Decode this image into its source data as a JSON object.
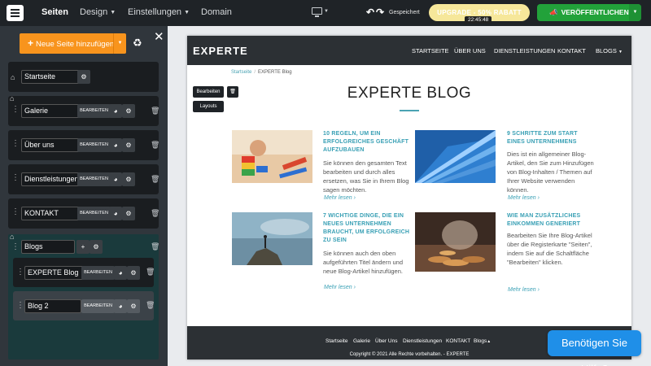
{
  "topbar": {
    "nav": [
      "Seiten",
      "Design",
      "Einstellungen",
      "Domain"
    ],
    "saved_label": "Gespeichert",
    "upgrade_label": "UPGRADE - 50% RABATT",
    "timer": "22:45:48",
    "publish_label": "VERÖFFENTLICHEN",
    "icons": [
      "menu-icon",
      "monitor-icon",
      "undo-icon",
      "redo-icon",
      "megaphone-icon"
    ]
  },
  "sidebar": {
    "add_page_label": "Neue Seite hinzufügen",
    "edit_label": "BEARBEITEN",
    "pages": [
      {
        "name": "Startseite"
      },
      {
        "name": "Galerie"
      },
      {
        "name": "Über uns"
      },
      {
        "name": "Dienstleistungen"
      },
      {
        "name": "KONTAKT"
      },
      {
        "name": "Blogs"
      }
    ],
    "subpages": [
      {
        "name": "EXPERTE Blog"
      },
      {
        "name": "Blog 2"
      }
    ],
    "group_color": "#1a3a3c"
  },
  "site": {
    "logo": "EXPERTE",
    "nav": [
      "STARTSEITE",
      "ÜBER UNS",
      "DIENSTLEISTUNGEN",
      "KONTAKT",
      "BLOGS"
    ],
    "breadcrumb": [
      "Startseite",
      "EXPERTE Blog"
    ],
    "edit_btn": "Bearbeiten",
    "layouts_btn": "Layouts",
    "blog_title": "EXPERTE BLOG",
    "read_more": "Mehr lesen",
    "posts": [
      {
        "title": "10 REGELN, UM EIN ERFOLGREICHES GESCHÄFT AUFZUBAUEN",
        "text": "Sie können den gesamten Text bearbeiten und durch alles ersetzen, was Sie in Ihrem Blog sagen möchten."
      },
      {
        "title": "9 SCHRITTE ZUM START EINES UNTERNEHMENS",
        "text": "Dies ist ein allgemeiner Blog-Artikel, den Sie zum Hinzufügen von Blog-Inhalten / Themen auf Ihrer Website verwenden können."
      },
      {
        "title": "7 WICHTIGE DINGE, DIE EIN NEUES UNTERNEHMEN BRAUCHT, UM ERFOLGREICH ZU SEIN",
        "text": "Sie können auch den oben aufgeführten Titel ändern und neue Blog-Artikel hinzufügen."
      },
      {
        "title": "WIE MAN ZUSÄTZLICHES EINKOMMEN GENERIERT",
        "text": "Bearbeiten Sie Ihre Blog-Artikel über die Registerkarte \"Seiten\", indem Sie auf die Schaltfläche \"Bearbeiten\" klicken."
      }
    ],
    "footer_nav": [
      "Startseite",
      "Galerie",
      "Über Uns",
      "Dienstleistungen",
      "KONTAKT",
      "Blogs"
    ],
    "copyright": "Copyright © 2021 Alle Rechte vorbehalten. - EXPERTE"
  },
  "help_label": "Benötigen Sie Hilfe?",
  "colors": {
    "accent": "#39a0b5",
    "publish": "#22a23a",
    "add": "#f8941d",
    "help": "#1f8fe8"
  }
}
